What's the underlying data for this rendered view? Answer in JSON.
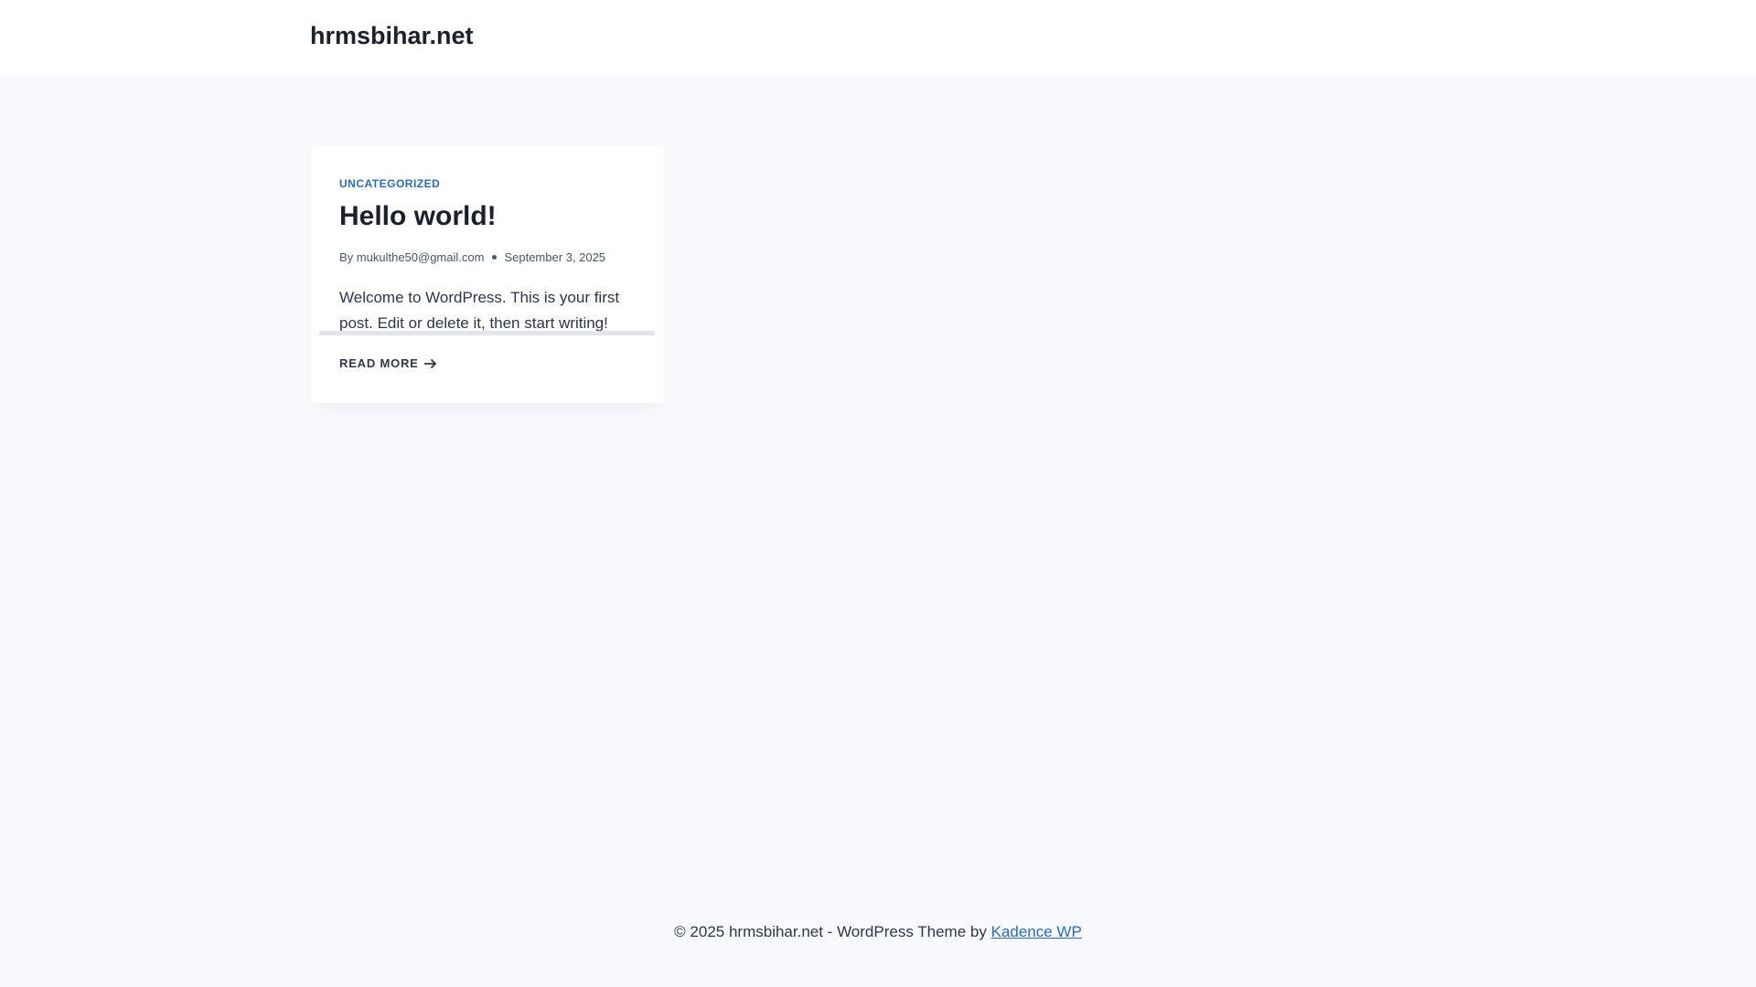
{
  "header": {
    "site_title": "hrmsbihar.net"
  },
  "post": {
    "category": "UNCATEGORIZED",
    "title": "Hello world!",
    "meta_by": "By",
    "author": "mukulthe50@gmail.com",
    "date": "September 3, 2025",
    "excerpt": "Welcome to WordPress. This is your first post. Edit or delete it, then start writing!",
    "read_more": "READ MORE",
    "read_more_icon": "arrow-right-icon"
  },
  "footer": {
    "copyright": "© 2025 hrmsbihar.net - WordPress Theme by",
    "theme_link": "Kadence WP"
  },
  "colors": {
    "background": "#f7f9fc",
    "header_bg": "#ffffff",
    "card_bg": "#ffffff",
    "accent": "#2b6cb0",
    "text_dark": "#1a202c",
    "text_body": "#2d3748",
    "text_meta": "#4a5568"
  }
}
